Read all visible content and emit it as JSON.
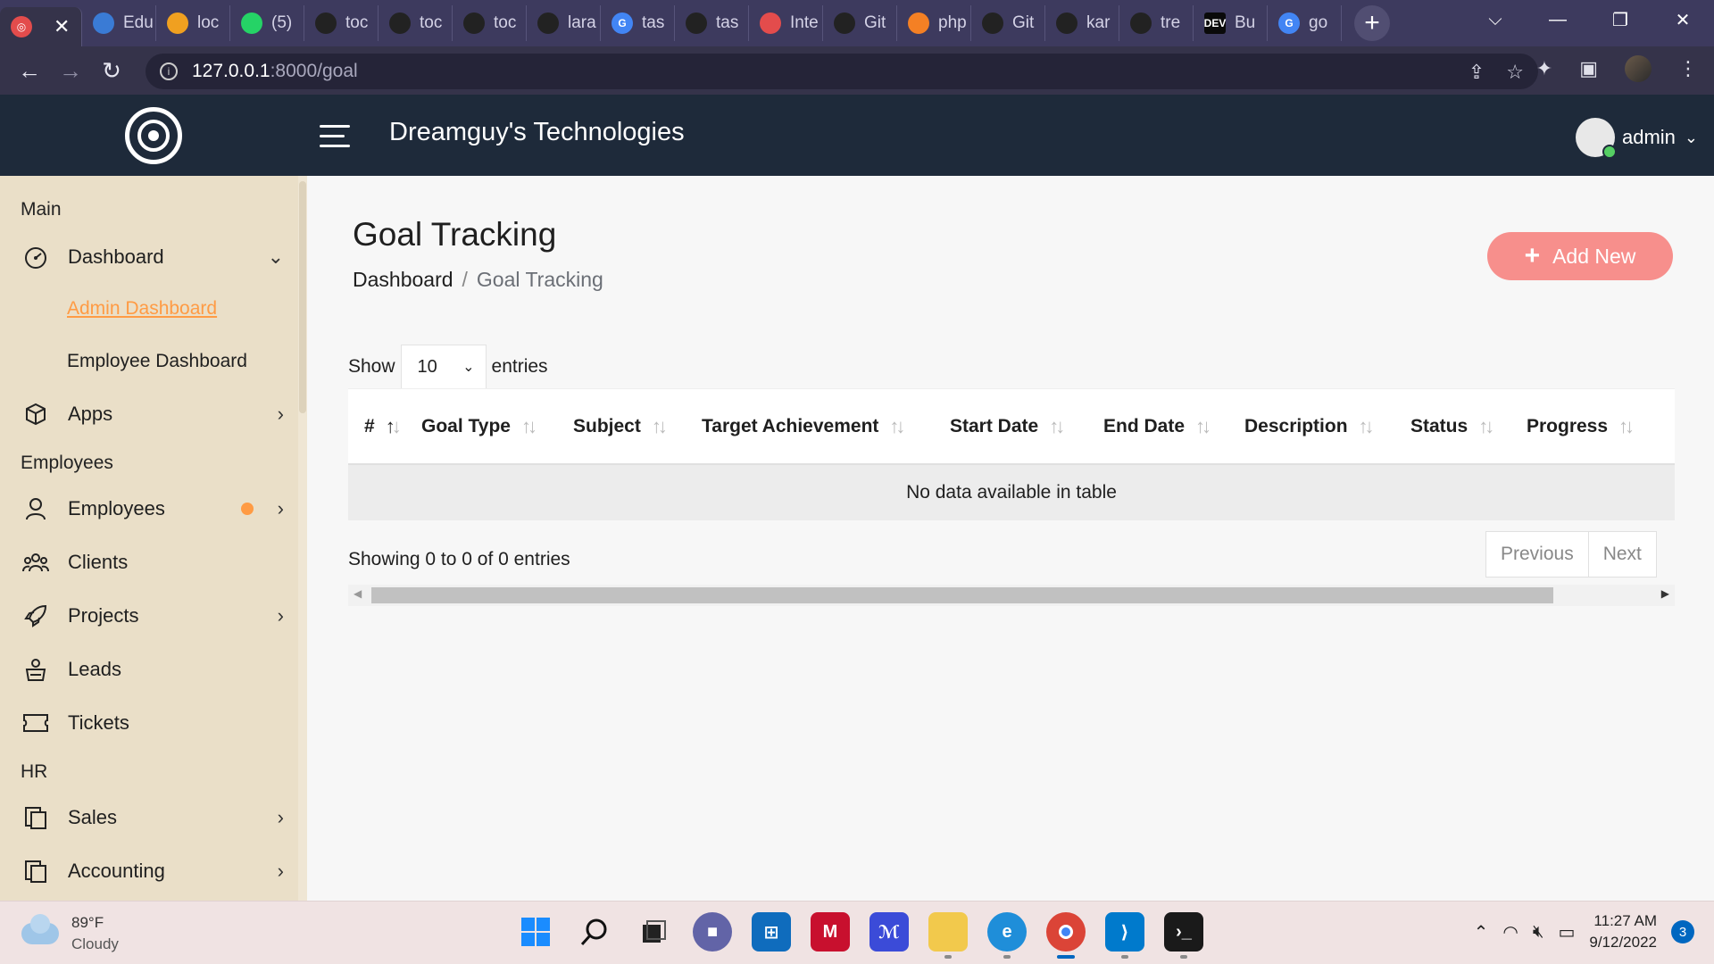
{
  "browser": {
    "tabs": [
      {
        "label": "",
        "favicon_color": "#e34c4c"
      },
      {
        "label": "Edu",
        "favicon_color": "#3a7bd5"
      },
      {
        "label": "loc",
        "favicon_color": "#f0a020"
      },
      {
        "label": "(5)",
        "favicon_color": "#25d366"
      },
      {
        "label": "toc",
        "favicon_color": "#222222"
      },
      {
        "label": "toc",
        "favicon_color": "#222222"
      },
      {
        "label": "toc",
        "favicon_color": "#222222"
      },
      {
        "label": "lara",
        "favicon_color": "#222222"
      },
      {
        "label": "tas",
        "favicon_color": "#4285f4"
      },
      {
        "label": "tas",
        "favicon_color": "#222222"
      },
      {
        "label": "Inte",
        "favicon_color": "#e34c4c"
      },
      {
        "label": "Git",
        "favicon_color": "#222222"
      },
      {
        "label": "php",
        "favicon_color": "#f48024"
      },
      {
        "label": "Git",
        "favicon_color": "#222222"
      },
      {
        "label": "kar",
        "favicon_color": "#222222"
      },
      {
        "label": "tre",
        "favicon_color": "#222222"
      },
      {
        "label": "Bu",
        "favicon_color": "#0a0a0a",
        "favicon_text": "DEV"
      },
      {
        "label": "go",
        "favicon_color": "#4285f4"
      }
    ],
    "new_tab_label": "+",
    "url_host": "127.0.0.1",
    "url_path": ":8000/goal"
  },
  "header": {
    "company": "Dreamguy's Technologies",
    "user_name": "admin"
  },
  "sidebar": {
    "sections": {
      "main": "Main",
      "employees": "Employees",
      "hr": "HR"
    },
    "items": {
      "dashboard": "Dashboard",
      "admin_dashboard": "Admin Dashboard",
      "employee_dashboard": "Employee Dashboard",
      "apps": "Apps",
      "employees": "Employees",
      "clients": "Clients",
      "projects": "Projects",
      "leads": "Leads",
      "tickets": "Tickets",
      "sales": "Sales",
      "accounting": "Accounting"
    }
  },
  "page": {
    "title": "Goal Tracking",
    "breadcrumb_home": "Dashboard",
    "breadcrumb_sep": "/",
    "breadcrumb_current": "Goal Tracking",
    "add_button": "Add New",
    "show_label": "Show",
    "entries_label": "entries",
    "page_size": "10",
    "columns": [
      "#",
      "Goal Type",
      "Subject",
      "Target Achievement",
      "Start Date",
      "End Date",
      "Description",
      "Status",
      "Progress"
    ],
    "empty_message": "No data available in table",
    "info": "Showing 0 to 0 of 0 entries",
    "previous": "Previous",
    "next": "Next"
  },
  "taskbar": {
    "temperature": "89°F",
    "condition": "Cloudy",
    "time": "11:27 AM",
    "date": "9/12/2022",
    "notifications": "3",
    "accent": "#0067c0"
  }
}
